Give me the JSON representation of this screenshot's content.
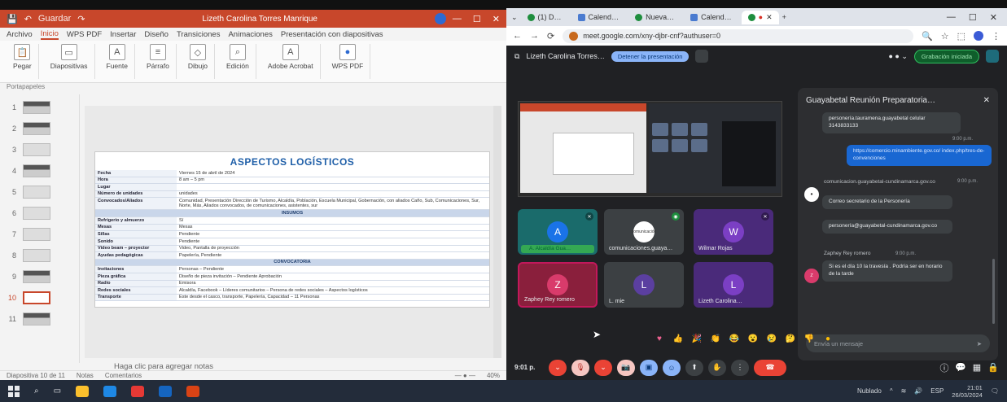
{
  "ppt": {
    "title": "Lizeth Carolina Torres Manrique",
    "quick_access": "Guardar",
    "tabs": [
      "Archivo",
      "Inicio",
      "WPS PDF",
      "Insertar",
      "Diseño",
      "Transiciones",
      "Animaciones",
      "Presentación con diapositivas"
    ],
    "ribbon": [
      {
        "label": "Pegar",
        "icon": "paste-icon"
      },
      {
        "label": "Diapositivas",
        "icon": "slides-icon"
      },
      {
        "label": "Fuente",
        "icon": "font-icon"
      },
      {
        "label": "Párrafo",
        "icon": "paragraph-icon"
      },
      {
        "label": "Dibujo",
        "icon": "drawing-icon"
      },
      {
        "label": "Edición",
        "icon": "editing-icon"
      },
      {
        "label": "Adobe Acrobat",
        "icon": "acrobat-icon"
      },
      {
        "label": "WPS PDF",
        "icon": "wps-pdf-icon"
      }
    ],
    "clipboard_label": "Portapapeles",
    "thumbs": [
      "1",
      "2",
      "3",
      "4",
      "5",
      "6",
      "7",
      "8",
      "9",
      "10",
      "11"
    ],
    "selected_thumb": "10",
    "slide": {
      "title": "ASPECTOS LOGÍSTICOS",
      "rows": [
        {
          "k": "Fecha",
          "v": "Viernes 15 de abril de 2024"
        },
        {
          "k": "Hora",
          "v": "8 am – 5 pm"
        },
        {
          "k": "Lugar",
          "v": ""
        },
        {
          "k": "Número de unidades",
          "v": "unidades"
        },
        {
          "k": "Convocados/Aliados",
          "v": "Comunidad, Presentación Dirección de Turismo, Alcaldía, Población, Escuela Municipal, Gobernación, con aliados Caño, Sub, Comunicaciones, Sur, Norte, Más, Aliados convocados, de comunicaciones, asistentes, sur"
        },
        {
          "sect": "INSUMOS"
        },
        {
          "k": "Refrigerio y almuerzo",
          "v": "Sí"
        },
        {
          "k": "Mesas",
          "v": "Mesas"
        },
        {
          "k": "Sillas",
          "v": "Pendiente"
        },
        {
          "k": "Sonido",
          "v": "Pendiente"
        },
        {
          "k": "Video beam – proyector",
          "v": "Video, Pantalla de proyección"
        },
        {
          "k": "Ayudas pedagógicas",
          "v": "Papelería, Pendiente"
        },
        {
          "sect": "CONVOCATORIA"
        },
        {
          "k": "Invitaciones",
          "v": "Personas – Pendiente"
        },
        {
          "k": "Pieza gráfica",
          "v": "Diseño de pieza invitación – Pendiente Aprobación"
        },
        {
          "k": "Radio",
          "v": "Emisora"
        },
        {
          "k": "Redes sociales",
          "v": "Alcaldía, Facebook – Líderes comunitarios – Persona de redes sociales – Aspectos logísticos"
        },
        {
          "k": "Transporte",
          "v": "Este desde el casco, transporte, Papelería, Capacidad – 11 Personas"
        }
      ]
    },
    "notes_placeholder": "Haga clic para agregar notas",
    "status": {
      "slide_counter": "Diapositiva 10 de 11",
      "notes": "Notas",
      "comments": "Comentarios",
      "zoom": "40%"
    }
  },
  "chrome": {
    "tabs": [
      {
        "label": "(1) D…",
        "fav": "g"
      },
      {
        "label": "Calend…",
        "fav": "b"
      },
      {
        "label": "Nueva…",
        "fav": "g"
      },
      {
        "label": "Calend…",
        "fav": "b"
      },
      {
        "label": "",
        "fav": "g"
      }
    ],
    "url": "meet.google.com/xny-djbr-cnf?authuser=0"
  },
  "meet": {
    "presenter_label": "Lizeth Carolina Torres…",
    "present_label": "Detener la presentación",
    "record_label": "Grabación iniciada",
    "tiles": [
      {
        "initial": "A",
        "color": "#1a73e8",
        "bg": "#1a6b6b",
        "name": "A. Alcaldía Gua…"
      },
      {
        "initial": "comunicación",
        "color": "#ffffff",
        "bg": "#3c4043",
        "name": "comunicaciones.guaya…"
      },
      {
        "initial": "W",
        "color": "#7b3fc4",
        "bg": "#4a2a7a",
        "name": "Wilmar Rojas"
      },
      {
        "initial": "Z",
        "color": "#d93b6b",
        "bg": "#8a1f3c",
        "name": "Zaphey Rey romero"
      },
      {
        "initial": "L",
        "color": "#5b3fa0",
        "bg": "#3c4043",
        "name": "L. mie"
      },
      {
        "initial": "L",
        "color": "#7b3fc4",
        "bg": "#4a2a7a",
        "name": "Lizeth Carolina…"
      }
    ],
    "chat": {
      "title": "Guayabetal Reunión Preparatoria…",
      "msg1": "personería.tauramena.guayabetal celular 3143833133",
      "time2": "9:00 p.m.",
      "msg2": "https://comercio.minambiente.gov.co/ index.php/tres-de-convenciones",
      "sender3": "comunicacion.guayabetal-cundinamarca.gov.co",
      "time3": "9:00 p.m.",
      "msg3a": "Correo secretario de la Personería",
      "msg3b": "personería@guayabetal-cundinamarca.gov.co",
      "sender4": "Zaphey Rey romero",
      "time4": "9:00 p.m.",
      "msg4": "Si es el día 10 la travesía . Podría ser en horario de la tarde",
      "input_placeholder": "Envía un mensaje"
    },
    "clock": "9:01 p.",
    "reactions": [
      "♥",
      "👍",
      "🎉",
      "👏",
      "😂",
      "😮",
      "😢",
      "🤔",
      "👎",
      "●"
    ]
  },
  "taskbar": {
    "search": "Buscar",
    "lang": "ESP",
    "time": "21:01",
    "date": "26/03/2024",
    "weather": "Nublado"
  }
}
